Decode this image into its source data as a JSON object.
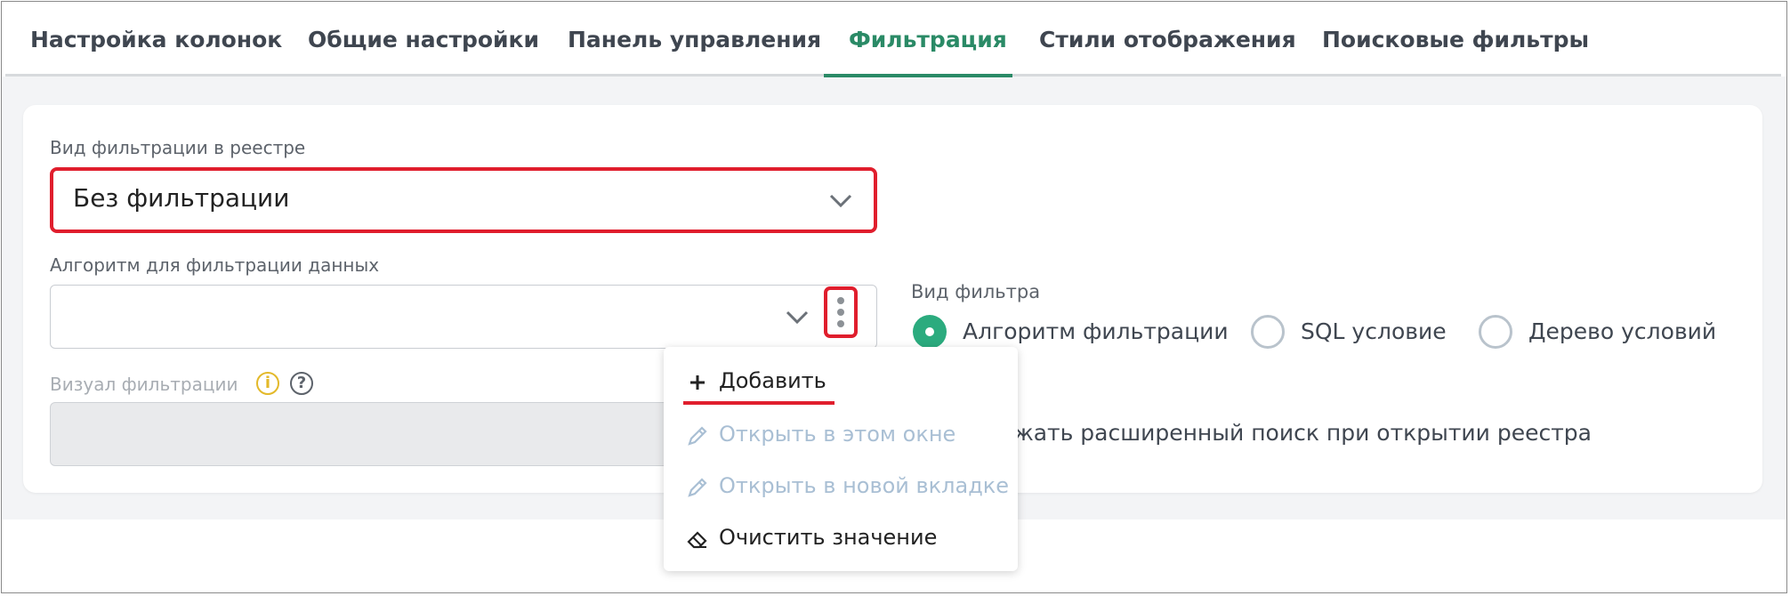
{
  "tabs": [
    {
      "label": "Настройка колонок"
    },
    {
      "label": "Общие настройки"
    },
    {
      "label": "Панель управления"
    },
    {
      "label": "Фильтрация",
      "active": true
    },
    {
      "label": "Стили отображения"
    },
    {
      "label": "Поисковые фильтры"
    }
  ],
  "form": {
    "filter_view_label": "Вид фильтрации в реестре",
    "filter_view_value": "Без фильтрации",
    "algorithm_label": "Алгоритм для фильтрации данных",
    "algorithm_value": "",
    "visual_label": "Визуал фильтрации",
    "visual_value": ""
  },
  "filter_type": {
    "label": "Вид фильтра",
    "options": [
      {
        "label": "Алгоритм фильтрации",
        "selected": true
      },
      {
        "label": "SQL условие",
        "selected": false
      },
      {
        "label": "Дерево условий",
        "selected": false
      }
    ]
  },
  "extended_search_text": "ражать расширенный поиск при открытии реестра",
  "menu": {
    "items": [
      {
        "label": "Добавить",
        "icon": "plus-icon",
        "enabled": true
      },
      {
        "label": "Открыть в этом окне",
        "icon": "pencil-icon",
        "enabled": false
      },
      {
        "label": "Открыть в новой вкладке",
        "icon": "pencil-icon",
        "enabled": false
      },
      {
        "label": "Очистить значение",
        "icon": "eraser-icon",
        "enabled": true
      }
    ]
  },
  "colors": {
    "accent": "#2a8a66",
    "radio_selected": "#2bab7e",
    "highlight": "#e01e2d",
    "info": "#e3b92a"
  }
}
